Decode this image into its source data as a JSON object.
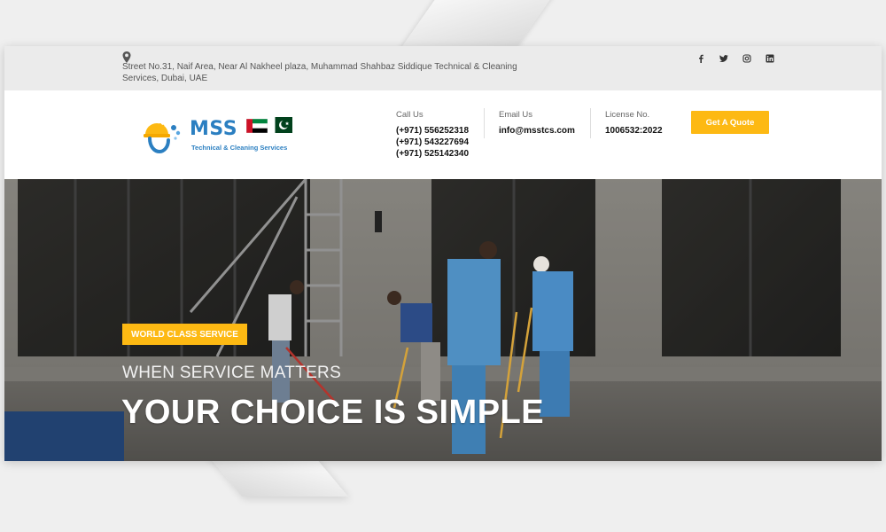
{
  "topbar": {
    "address": "Street No.31, Naif Area, Near Al Nakheel plaza, Muhammad Shahbaz Siddique Technical & Cleaning Services, Dubai, UAE",
    "socials": [
      "facebook-icon",
      "twitter-icon",
      "instagram-icon",
      "linkedin-icon"
    ]
  },
  "header": {
    "logo_text": "MSS",
    "logo_subtitle": "Technical & Cleaning Services",
    "phone_label": "Call Us",
    "phones": [
      "(+971) 556252318",
      "(+971) 543227694",
      "(+971) 525142340"
    ],
    "email_label": "Email Us",
    "email": "info@msstcs.com",
    "license_label": "License No.",
    "license": "1006532:2022",
    "quote_button": "Get A Quote"
  },
  "hero": {
    "badge": "WORLD CLASS SERVICE",
    "subtitle": "WHEN SERVICE MATTERS",
    "headline": "YOUR CHOICE IS SIMPLE"
  },
  "colors": {
    "accent": "#fdb913",
    "brand_blue": "#2b7fc1",
    "topbar_bg": "#ebebeb"
  }
}
